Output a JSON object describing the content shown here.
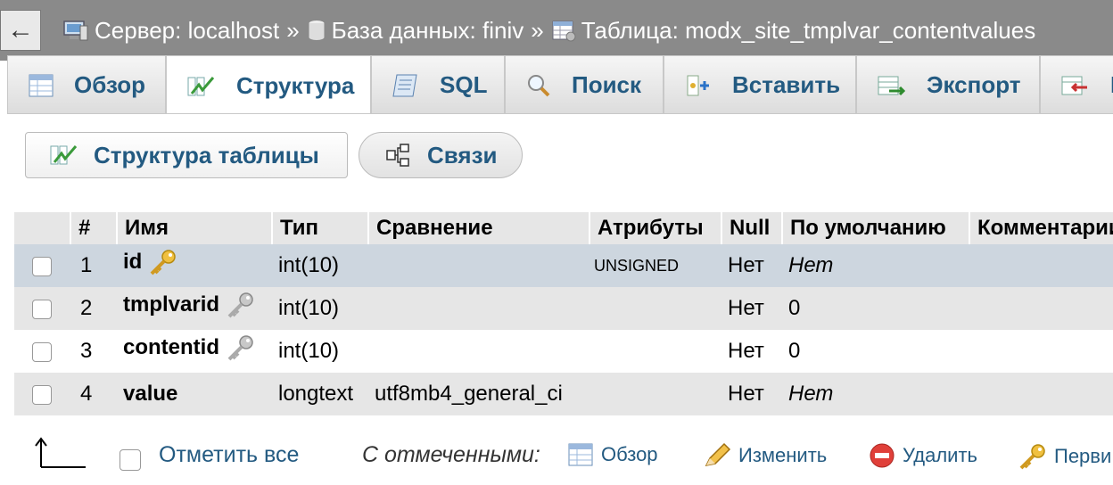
{
  "breadcrumb": {
    "back_symbol": "←",
    "server": "Сервер: localhost",
    "database": "База данных: finiv",
    "table": "Таблица: modx_site_tmplvar_contentvalues",
    "separator": "»"
  },
  "tabs": [
    {
      "label": "Обзор",
      "icon": "browse-icon"
    },
    {
      "label": "Структура",
      "icon": "structure-icon",
      "active": true
    },
    {
      "label": "SQL",
      "icon": "sql-icon"
    },
    {
      "label": "Поиск",
      "icon": "search-icon"
    },
    {
      "label": "Вставить",
      "icon": "insert-icon"
    },
    {
      "label": "Экспорт",
      "icon": "export-icon"
    },
    {
      "label": "И",
      "icon": "import-icon"
    }
  ],
  "subtabs": {
    "structure": "Структура таблицы",
    "relations": "Связи"
  },
  "table": {
    "headers": {
      "num": "#",
      "name": "Имя",
      "type": "Тип",
      "collation": "Сравнение",
      "attributes": "Атрибуты",
      "null": "Null",
      "default": "По умолчанию",
      "comment": "Комментарии"
    },
    "rows": [
      {
        "num": "1",
        "name": "id",
        "key": "primary",
        "type": "int(10)",
        "collation": "",
        "attributes": "UNSIGNED",
        "null": "Нет",
        "default": "Нет"
      },
      {
        "num": "2",
        "name": "tmplvarid",
        "key": "index",
        "type": "int(10)",
        "collation": "",
        "attributes": "",
        "null": "Нет",
        "default": "0"
      },
      {
        "num": "3",
        "name": "contentid",
        "key": "index",
        "type": "int(10)",
        "collation": "",
        "attributes": "",
        "null": "Нет",
        "default": "0"
      },
      {
        "num": "4",
        "name": "value",
        "key": "",
        "type": "longtext",
        "collation": "utf8mb4_general_ci",
        "attributes": "",
        "null": "Нет",
        "default": "Нет"
      }
    ]
  },
  "footer": {
    "check_all": "Отметить все",
    "with_selected": "С отмеченными:",
    "browse": "Обзор",
    "change": "Изменить",
    "drop": "Удалить",
    "primary": "Перви"
  },
  "colors": {
    "link": "#235a81",
    "header_bg": "#8a8a8a",
    "selected_row": "#cdd6df",
    "drop_icon": "#e0403a",
    "key_gold": "#e8b62a"
  }
}
